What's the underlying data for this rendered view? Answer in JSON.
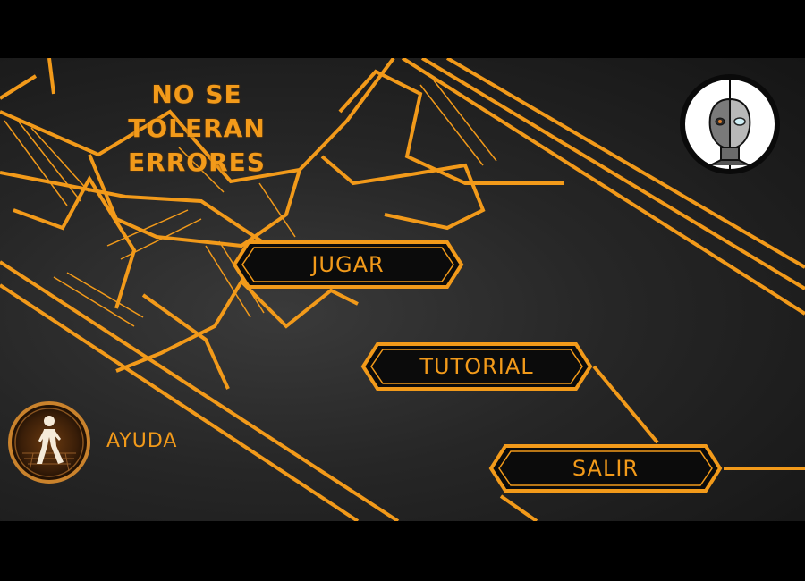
{
  "game": {
    "title_line1": "NO SE TOLERAN",
    "title_line2": "ERRORES"
  },
  "menu": {
    "play_label": "JUGAR",
    "tutorial_label": "TUTORIAL",
    "exit_label": "SALIR"
  },
  "help": {
    "label": "AYUDA",
    "icon": "walking-person-icon"
  },
  "profile": {
    "icon": "robot-face-icon"
  },
  "colors": {
    "accent": "#f29a1a",
    "background": "#222222",
    "button_fill": "#0b0b0b"
  }
}
